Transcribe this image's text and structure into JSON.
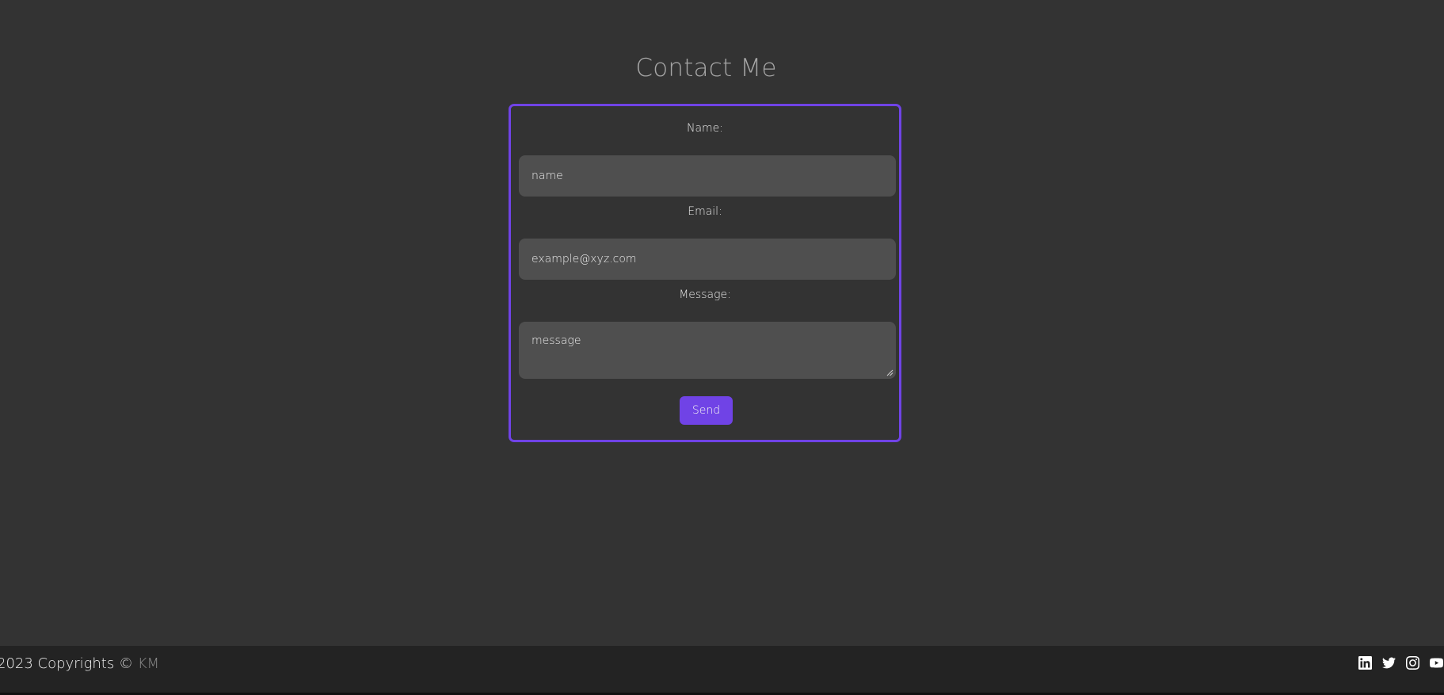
{
  "page": {
    "title": "Contact Me"
  },
  "form": {
    "name_label": "Name:",
    "name_placeholder": "name",
    "email_label": "Email:",
    "email_placeholder": "example@xyz.com",
    "message_label": "Message:",
    "message_placeholder": "message",
    "send_label": "Send"
  },
  "footer": {
    "copyright_prefix": "2023 Copyrights ©",
    "brand": "KM",
    "social_icons": [
      "linkedin-icon",
      "twitter-icon",
      "instagram-icon",
      "youtube-icon"
    ]
  },
  "colors": {
    "accent": "#7043e6",
    "background": "#333333",
    "input_background": "#4f4f4f",
    "footer_background": "#232323"
  }
}
